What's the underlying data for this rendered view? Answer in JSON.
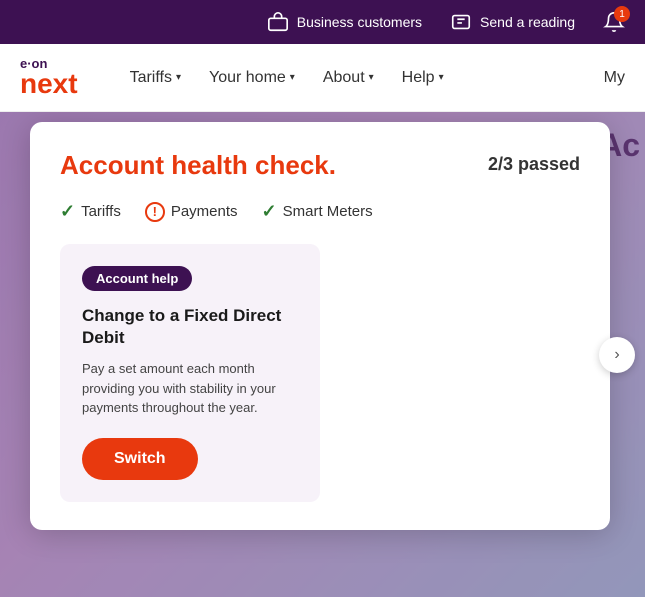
{
  "topbar": {
    "business_label": "Business customers",
    "send_reading_label": "Send a reading",
    "notification_count": "1"
  },
  "navbar": {
    "logo_eon": "e·on",
    "logo_next": "next",
    "tariffs_label": "Tariffs",
    "your_home_label": "Your home",
    "about_label": "About",
    "help_label": "Help",
    "my_label": "My"
  },
  "modal": {
    "title": "Account health check.",
    "score": "2/3 passed",
    "checks": [
      {
        "label": "Tariffs",
        "status": "pass"
      },
      {
        "label": "Payments",
        "status": "warn"
      },
      {
        "label": "Smart Meters",
        "status": "pass"
      }
    ],
    "card": {
      "badge": "Account help",
      "title": "Change to a Fixed Direct Debit",
      "desc": "Pay a set amount each month providing you with stability in your payments throughout the year.",
      "switch_label": "Switch"
    }
  },
  "background": {
    "partial_text": "Ac"
  },
  "colors": {
    "purple_dark": "#3d1152",
    "orange": "#e8390e",
    "check_green": "#2e7d32"
  }
}
